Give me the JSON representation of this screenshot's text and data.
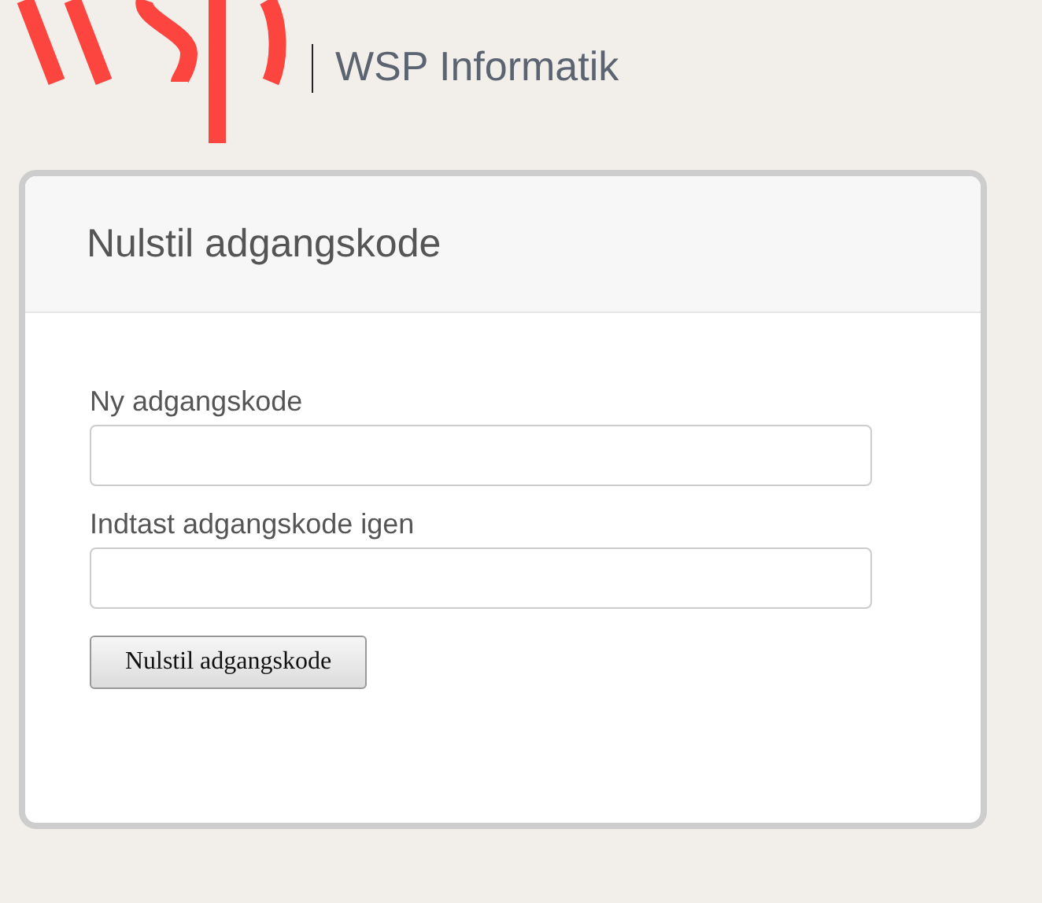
{
  "header": {
    "brand": "WSP Informatik"
  },
  "panel": {
    "title": "Nulstil adgangskode",
    "fields": [
      {
        "label": "Ny adgangskode"
      },
      {
        "label": "Indtast adgangskode igen"
      }
    ],
    "button": "Nulstil adgangskode"
  }
}
